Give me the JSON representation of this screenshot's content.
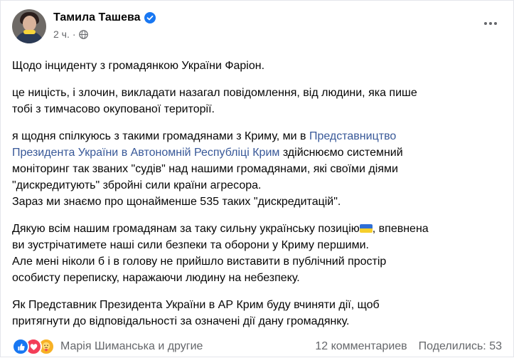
{
  "post": {
    "author": "Тамила Ташева",
    "time": "2 ч.",
    "paragraphs": {
      "p1": {
        "l1": "Щодо інциденту з громадянкою України Фаріон."
      },
      "p2": {
        "l1": "це ницість, і злочин, викладати назагал повідомлення, від людини, яка пише",
        "l2": "тобі з тимчасово окупованої території."
      },
      "p3": {
        "l1_a": "я щодня спілкуюсь з такими громадянами з Криму, ми в ",
        "l1_link": "Представництво",
        "l2_link": "Президента України в Автономній Республіці Крим",
        "l2_b": " здійснюємо системний",
        "l3": "моніторинг так званих \"судів\" над нашими громадянами, які своїми діями",
        "l4": "\"дискредитують\" збройні сили країни агресора.",
        "l5": "Зараз ми знаємо про щонайменше 535 таких \"дискредитацій\"."
      },
      "p4": {
        "l1_a": "Дякую всім нашим громадянам за таку сильну українську позицію",
        "l1_b": ", впевнена",
        "l2": "ви зустрічатимете наші сили безпеки та оборони у Криму першими.",
        "l3": "Але мені ніколи б і в голову не прийшло виставити в публічний простір",
        "l4": "особисту переписку, наражаючи людину на небезпеку."
      },
      "p5": {
        "l1": "Як Представник Президента України в АР Крим буду вчиняти дії, щоб",
        "l2": "притягнути до відповідальності за означені дії дану громадянку."
      }
    }
  },
  "footer": {
    "reacted_by": "Марія Шиманська и другие",
    "comments": "12 комментариев",
    "shares": "Поделились: 53"
  },
  "icons": {
    "verified": "verified-badge-icon",
    "privacy": "globe-icon",
    "more": "more-options-icon",
    "flag": "ukraine-flag-emoji",
    "reactions": [
      "like-reaction-icon",
      "love-reaction-icon",
      "care-reaction-icon"
    ]
  },
  "colors": {
    "link": "#385898",
    "meta": "#65676b",
    "like": "#1877f2",
    "love": "#f33e58",
    "care": "#f7b125"
  }
}
